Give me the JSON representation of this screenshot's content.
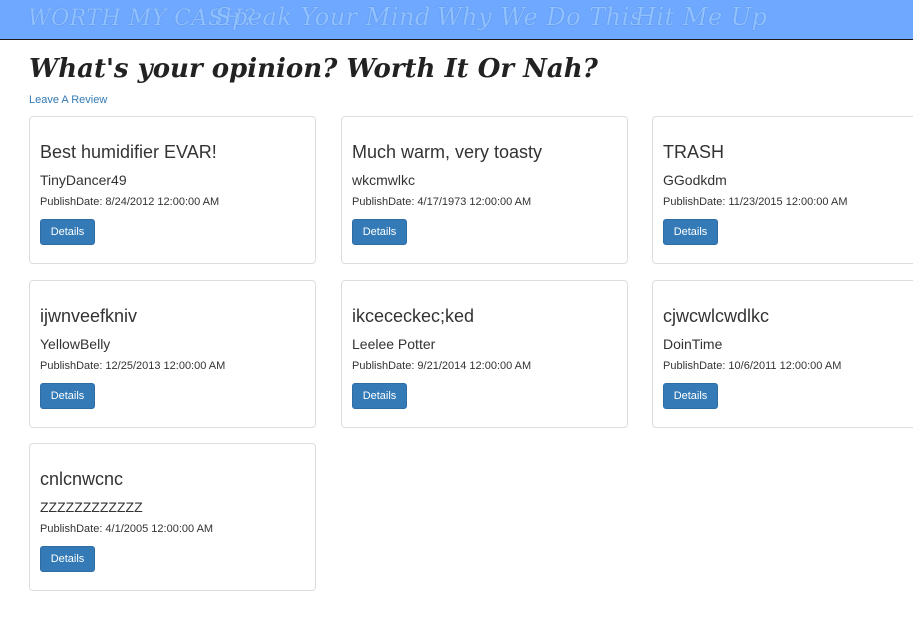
{
  "nav": {
    "brand": "WORTH MY CASH?",
    "links": [
      "Speak Your Mind",
      "Why We Do This",
      "Hit Me Up"
    ]
  },
  "page": {
    "title": "What's your opinion? Worth It Or Nah?",
    "review_link": "Leave A Review",
    "date_label": "PublishDate:",
    "details_label": "Details"
  },
  "reviews": [
    {
      "title": "Best humidifier EVAR!",
      "author": "TinyDancer49",
      "date": "PublishDate: 8/24/2012 12:00:00 AM"
    },
    {
      "title": "Much warm, very toasty",
      "author": "wkcmwlkc",
      "date": "PublishDate: 4/17/1973 12:00:00 AM"
    },
    {
      "title": "TRASH",
      "author": "GGodkdm",
      "date": "PublishDate: 11/23/2015 12:00:00 AM"
    },
    {
      "title": "ijwnveefkniv",
      "author": "YellowBelly",
      "date": "PublishDate: 12/25/2013 12:00:00 AM"
    },
    {
      "title": "ikcececkec;ked",
      "author": "Leelee Potter",
      "date": "PublishDate: 9/21/2014 12:00:00 AM"
    },
    {
      "title": "cjwcwlcwdlkc",
      "author": "DoinTime",
      "date": "PublishDate: 10/6/2011 12:00:00 AM"
    },
    {
      "title": "cnlcnwcnc",
      "author": "ZZZZZZZZZZZZ",
      "date": "PublishDate: 4/1/2005 12:00:00 AM"
    }
  ],
  "colors": {
    "navbar": "#6fa8ff",
    "nav_text": "#8fc1ff",
    "button": "#337ab7",
    "link": "#337ab7"
  }
}
